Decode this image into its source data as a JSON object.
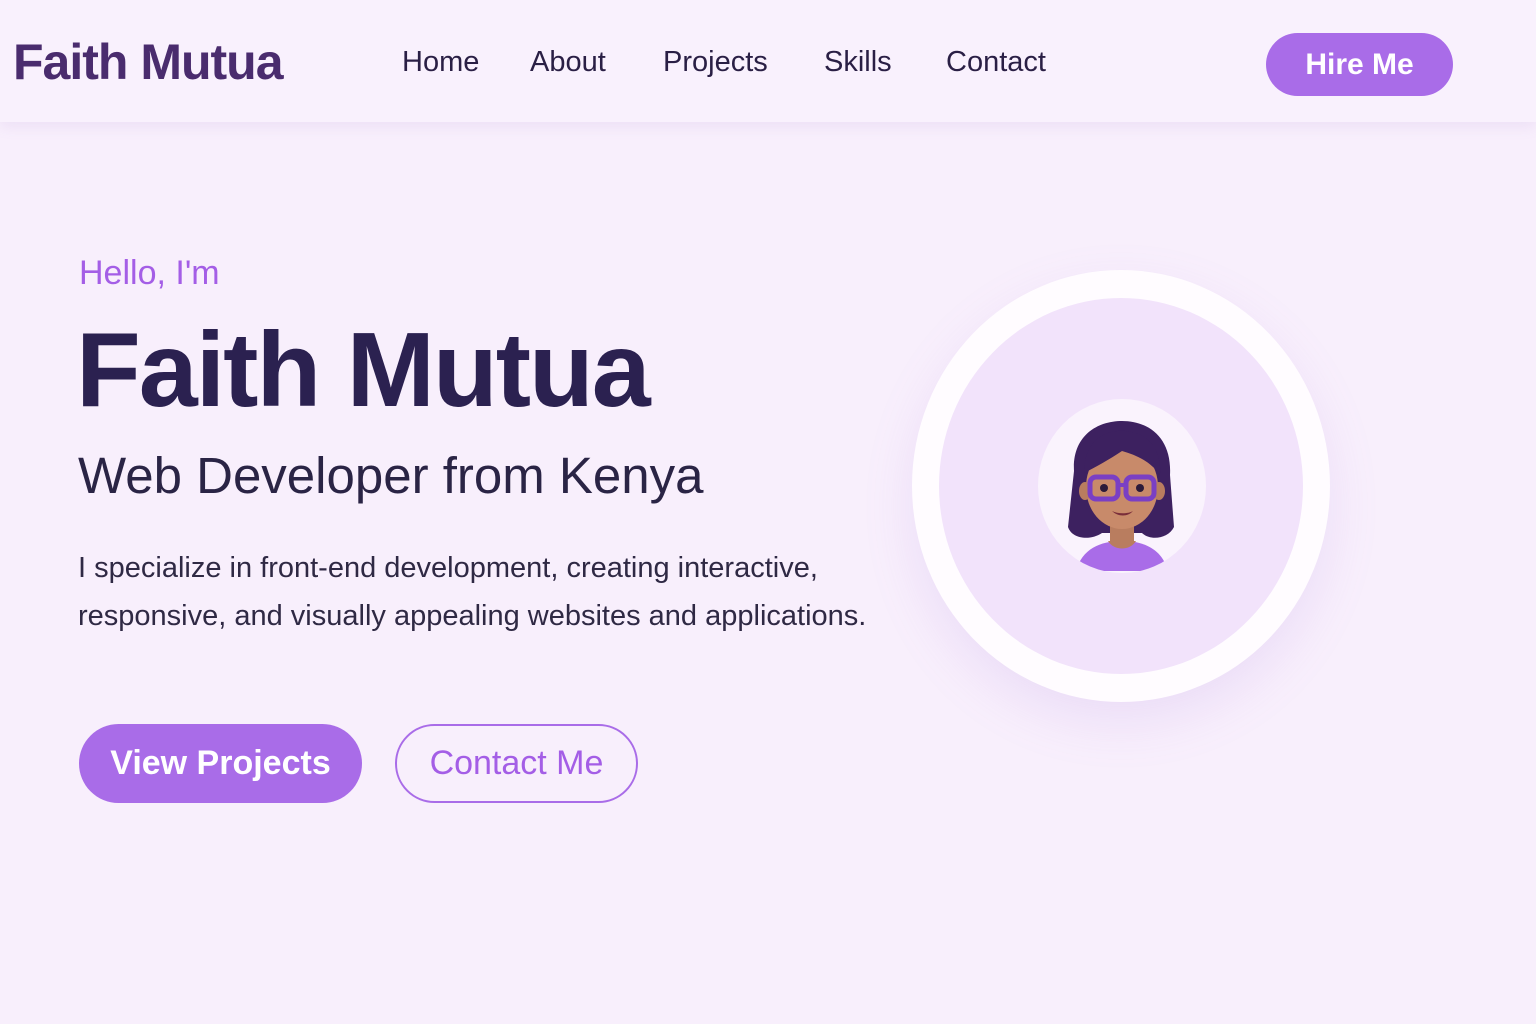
{
  "header": {
    "logo": "Faith Mutua",
    "nav": [
      {
        "label": "Home"
      },
      {
        "label": "About"
      },
      {
        "label": "Projects"
      },
      {
        "label": "Skills"
      },
      {
        "label": "Contact"
      }
    ],
    "hire_label": "Hire Me"
  },
  "hero": {
    "greeting": "Hello, I'm",
    "name": "Faith Mutua",
    "role": "Web Developer from Kenya",
    "description": "I specialize in front-end development, creating interactive, responsive, and visually appealing websites and applications.",
    "primary_button": "View Projects",
    "secondary_button": "Contact Me"
  },
  "avatar": {
    "icon": "woman-with-glasses-illustration"
  },
  "colors": {
    "accent": "#a96ce8",
    "accent_text": "#a45ee6",
    "heading": "#2b2150",
    "logo": "#4a2c6e",
    "background": "#f8effc"
  }
}
